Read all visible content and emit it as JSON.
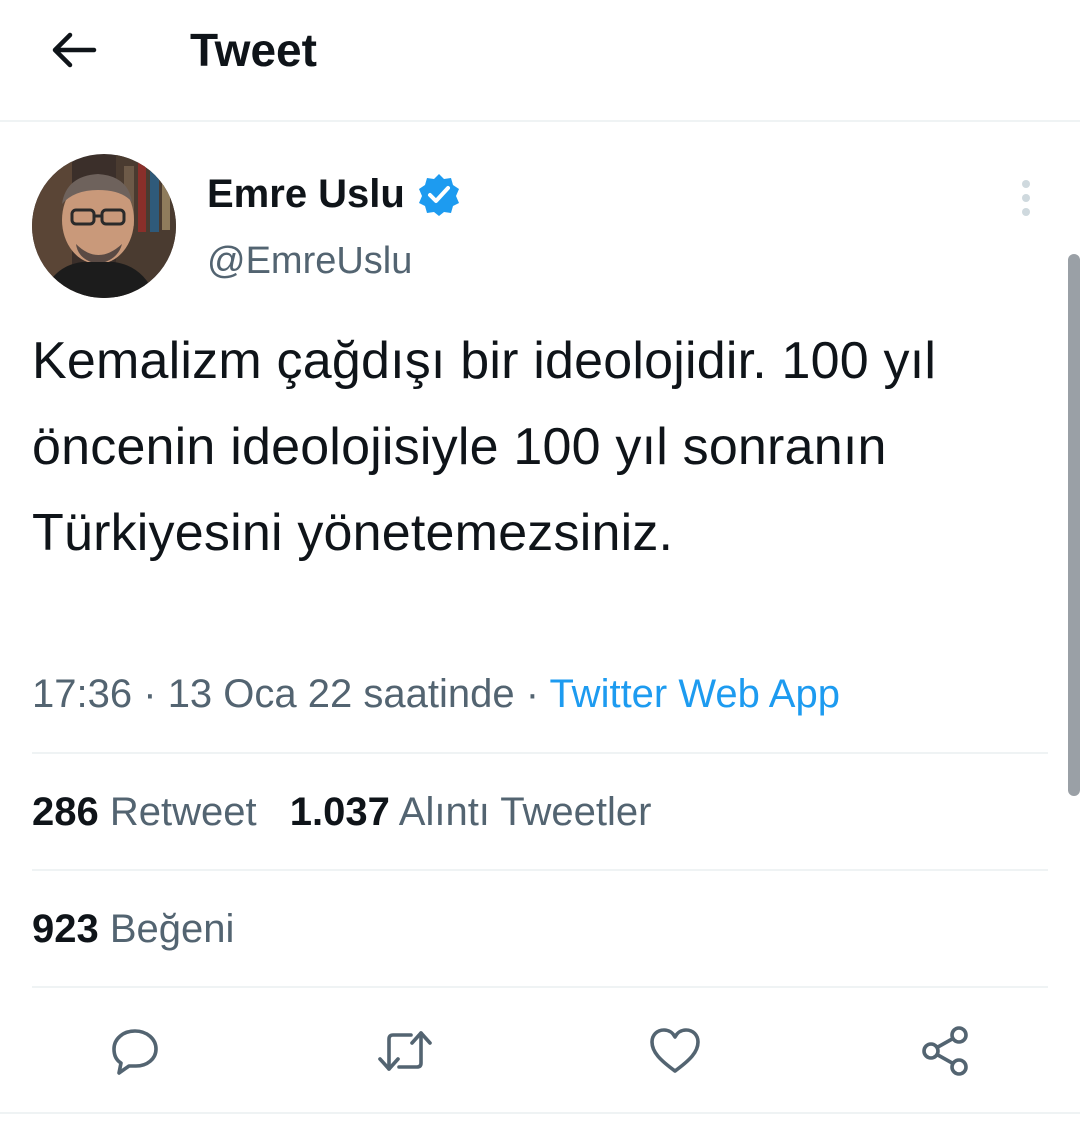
{
  "header": {
    "title": "Tweet"
  },
  "tweet": {
    "author": {
      "display_name": "Emre Uslu",
      "handle": "@EmreUslu",
      "verified": true
    },
    "text": "Kemalizm çağdışı bir ideolojidir. 100 yıl öncenin ideolojisiyle 100 yıl sonranın Türkiyesini yönetemezsiniz.",
    "time": "17:36",
    "date": "13 Oca 22 saatinde",
    "separator": "·",
    "source": "Twitter Web App"
  },
  "stats": {
    "retweets_count": "286",
    "retweets_label": "Retweet",
    "quotes_count": "1.037",
    "quotes_label": "Alıntı Tweetler",
    "likes_count": "923",
    "likes_label": "Beğeni"
  },
  "colors": {
    "text_primary": "#0f1419",
    "text_secondary": "#536471",
    "accent": "#1d9bf0",
    "divider": "#eff3f4"
  },
  "icons": {
    "back": "arrow-left-icon",
    "verified": "verified-badge-icon",
    "more": "vertical-dots-icon",
    "reply": "speech-bubble-icon",
    "retweet": "retweet-arrows-icon",
    "like": "heart-icon",
    "share": "share-icon"
  }
}
